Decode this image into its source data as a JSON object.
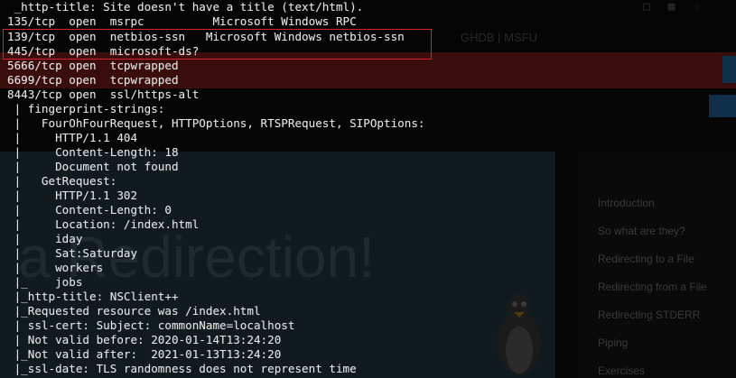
{
  "terminal": {
    "lines": [
      " _http-title: Site doesn't have a title (text/html).",
      "135/tcp  open  msrpc          Microsoft Windows RPC",
      "139/tcp  open  netbios-ssn   Microsoft Windows netbios-ssn",
      "445/tcp  open  microsoft-ds?",
      "5666/tcp open  tcpwrapped",
      "6699/tcp open  tcpwrapped",
      "8443/tcp open  ssl/https-alt",
      " | fingerprint-strings:",
      " |   FourOhFourRequest, HTTPOptions, RTSPRequest, SIPOptions:",
      " |     HTTP/1.1 404",
      " |     Content-Length: 18",
      " |     Document not found",
      " |   GetRequest:",
      " |     HTTP/1.1 302",
      " |     Content-Length: 0",
      " |     Location: /index.html",
      " |     iday",
      " |     Sat:Saturday",
      " |     workers",
      " |_    jobs",
      " |_http-title: NSClient++",
      " |_Requested resource was /index.html",
      " | ssl-cert: Subject: commonName=localhost",
      " | Not valid before: 2020-01-14T13:24:20",
      " |_Not valid after:  2021-01-13T13:24:20",
      " |_ssl-date: TLS randomness does not represent time"
    ],
    "highlight_color": "#e02020"
  },
  "background_page": {
    "nav_links": "GHDB  |  MSFU",
    "headline": "a  Redirection!",
    "toc_items": [
      "Introduction",
      "So what are they?",
      "Redirecting to a File",
      "Redirecting from a File",
      "Redirecting STDERR",
      "Piping",
      "Exercises"
    ],
    "corner_icons": [
      "window-icon",
      "square-icon",
      "star-icon"
    ]
  }
}
